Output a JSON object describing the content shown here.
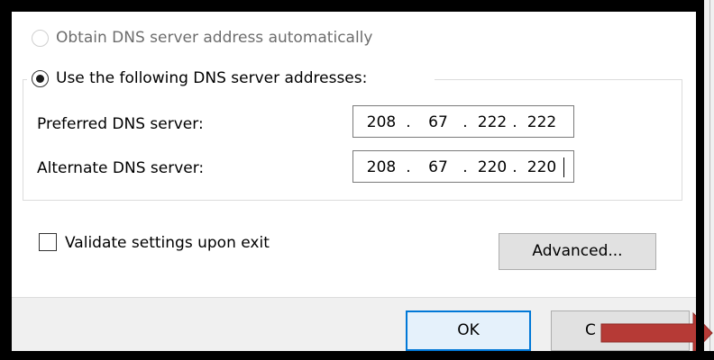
{
  "dns": {
    "auto_label": "Obtain DNS server address automatically",
    "manual_label": "Use the following DNS server addresses:",
    "preferred_label": "Preferred DNS server:",
    "preferred_ip": [
      "208",
      "67",
      "222",
      "222"
    ],
    "alternate_label": "Alternate DNS server:",
    "alternate_ip": [
      "208",
      "67",
      "220",
      "220"
    ]
  },
  "validate_label": "Validate settings upon exit",
  "buttons": {
    "advanced": "Advanced...",
    "ok": "OK",
    "cancel_partial": "C"
  },
  "colors": {
    "ok_border": "#0078d7",
    "arrow": "#b63a36"
  },
  "icons": {
    "arrow": "right-arrow-annotation-icon"
  }
}
